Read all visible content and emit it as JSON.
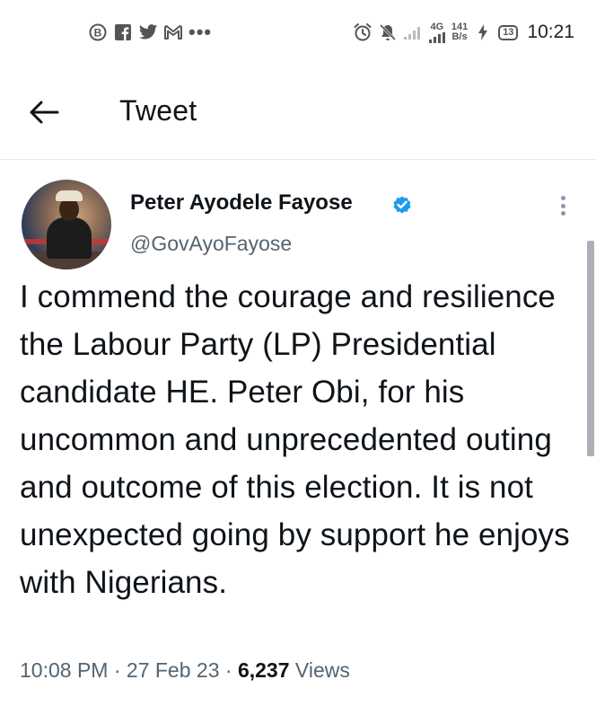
{
  "status_bar": {
    "left_icons": [
      "b-circle-icon",
      "facebook-icon",
      "twitter-icon",
      "gmail-icon"
    ],
    "more_dots": "•••",
    "net_type": "4G",
    "net_speed_value": "141",
    "net_speed_unit": "B/s",
    "battery_level": "13",
    "time": "10:21"
  },
  "header": {
    "title": "Tweet"
  },
  "tweet": {
    "author_name": "Peter Ayodele Fayose",
    "handle": "@GovAyoFayose",
    "text": "I commend the courage and resilience the Labour Party (LP) Presidential candidate HE. Peter Obi, for his uncommon and unprecedented outing and outcome of this election. It is not unexpected going by support he enjoys with Nigerians.",
    "time": "10:08 PM",
    "separator": "·",
    "date": "27 Feb 23",
    "views_count": "6,237",
    "views_label": "Views"
  },
  "colors": {
    "verified_blue": "#1d9bf0",
    "secondary_text": "#536471",
    "primary_text": "#0f1419"
  }
}
